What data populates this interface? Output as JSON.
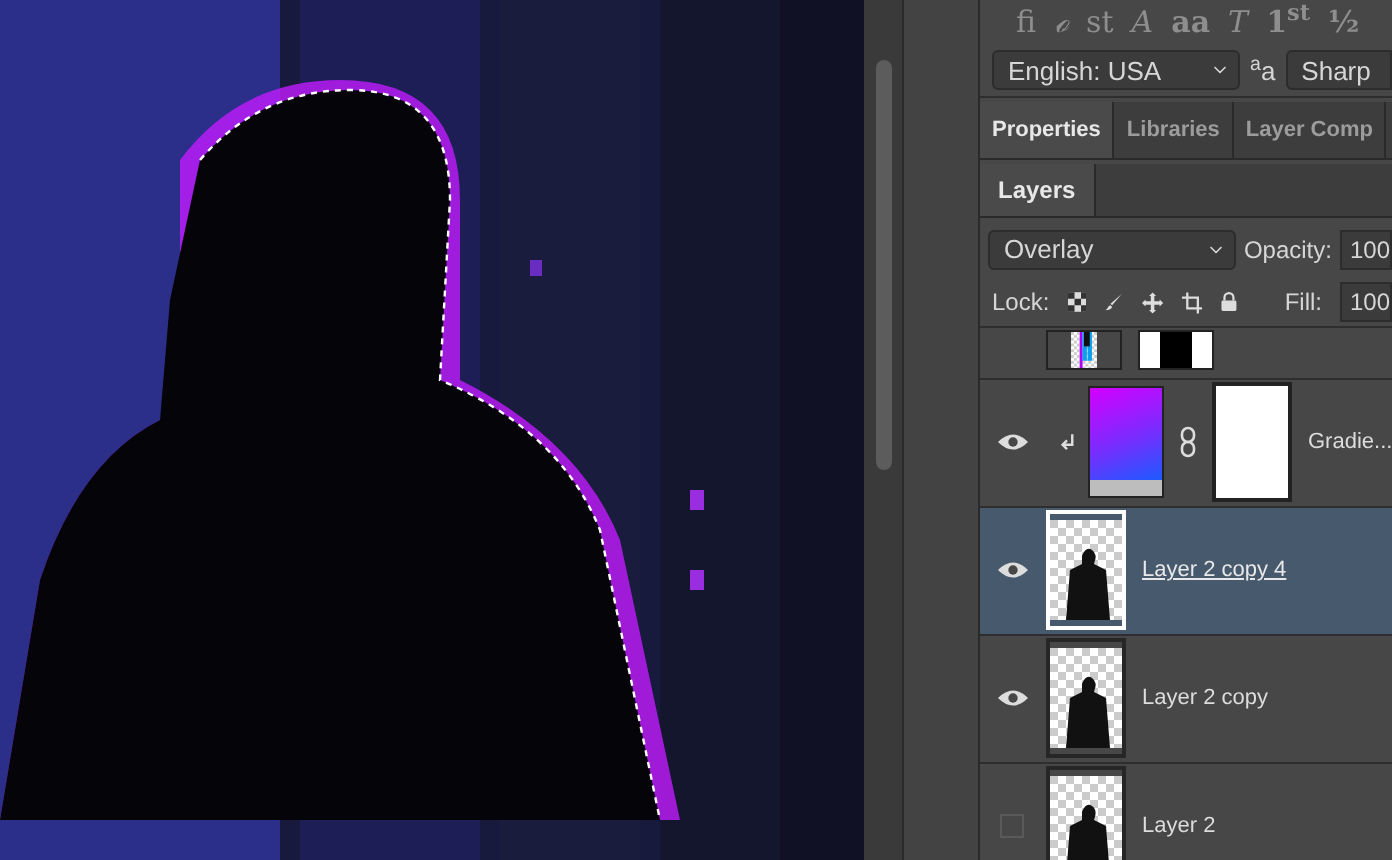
{
  "glyphs": [
    {
      "label": "fi",
      "kind": "serif"
    },
    {
      "label": "ℴ",
      "kind": "italic"
    },
    {
      "label": "st",
      "kind": "serif"
    },
    {
      "label": "A",
      "kind": "italic"
    },
    {
      "label": "aa",
      "kind": "bold"
    },
    {
      "label": "T",
      "kind": "italic"
    },
    {
      "label": "1$^{st}$",
      "kind": "bold"
    },
    {
      "label": "½",
      "kind": "bold"
    }
  ],
  "language": {
    "value": "English: USA"
  },
  "antialias_icon": "$^{a}$a",
  "antialias": {
    "value": "Sharp"
  },
  "tabs": [
    {
      "label": "Properties",
      "selected": true
    },
    {
      "label": "Libraries",
      "selected": false
    },
    {
      "label": "Layer Comp",
      "selected": false
    }
  ],
  "layers_tabs": [
    {
      "label": "Layers",
      "selected": true
    }
  ],
  "blend_mode": {
    "value": "Overlay"
  },
  "opacity": {
    "label": "Opacity:",
    "value": "100"
  },
  "lock": {
    "label": "Lock:"
  },
  "fill": {
    "label": "Fill:",
    "value": "100"
  },
  "layers": [
    {
      "kind": "composite",
      "mask": true,
      "clipped": false
    },
    {
      "name": "Gradie...",
      "visible": true,
      "selected": false,
      "kind": "gradient",
      "mask": true,
      "clipped": true
    },
    {
      "name": "Layer 2 copy 4",
      "visible": true,
      "selected": true,
      "kind": "figure",
      "mask": false,
      "clipped": false
    },
    {
      "name": "Layer 2 copy",
      "visible": true,
      "selected": false,
      "kind": "figure",
      "mask": false,
      "clipped": false
    },
    {
      "name": "Layer 2",
      "visible": false,
      "selected": false,
      "kind": "figure",
      "mask": false,
      "clipped": false
    }
  ]
}
